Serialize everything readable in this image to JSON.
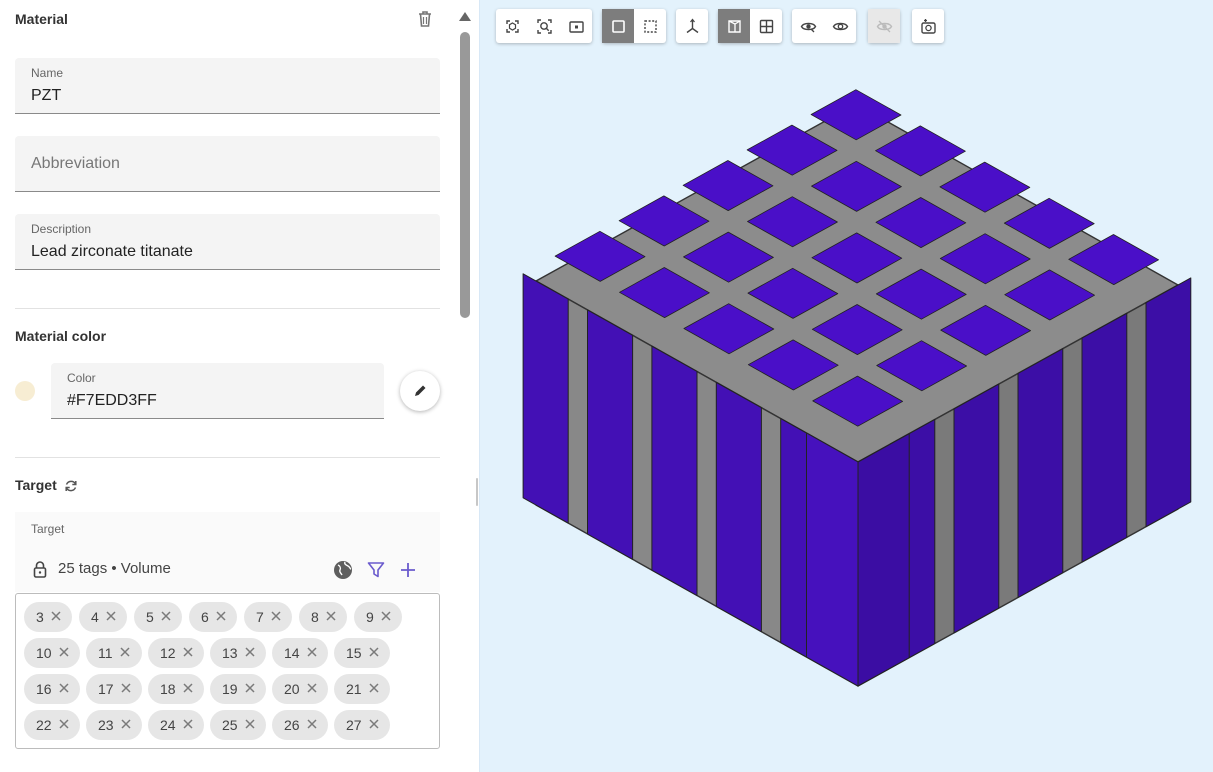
{
  "material_panel": {
    "title": "Material",
    "name_field": {
      "label": "Name",
      "value": "PZT"
    },
    "abbreviation_field": {
      "placeholder": "Abbreviation",
      "value": ""
    },
    "description_field": {
      "label": "Description",
      "value": "Lead zirconate titanate"
    },
    "color_section": {
      "title": "Material color",
      "field": {
        "label": "Color",
        "value": "#F7EDD3FF"
      },
      "swatch_color": "#F7EDD3"
    },
    "target_section": {
      "title": "Target",
      "box_label": "Target",
      "summary": "25 tags • Volume",
      "tags": [
        "3",
        "4",
        "5",
        "6",
        "7",
        "8",
        "9",
        "10",
        "11",
        "12",
        "13",
        "14",
        "15",
        "16",
        "17",
        "18",
        "19",
        "20",
        "21",
        "22",
        "23",
        "24",
        "25",
        "26",
        "27"
      ]
    }
  },
  "viewer": {
    "background": "#E3F2FC",
    "toolbar_groups": [
      [
        "fit-all-icon",
        "zoom-box-icon",
        "frame-icon"
      ],
      [
        "solid-view-icon",
        "dashed-view-icon"
      ],
      [
        "axes-icon"
      ],
      [
        "cut-plane-icon",
        "grid-icon"
      ],
      [
        "hide-icon",
        "show-icon"
      ],
      [
        "visibility-disabled-icon"
      ],
      [
        "screenshot-icon"
      ]
    ],
    "model": {
      "grid_size": 5,
      "pillar_color": "#4A0FC8",
      "matrix_color": "#8C8C8C"
    }
  }
}
